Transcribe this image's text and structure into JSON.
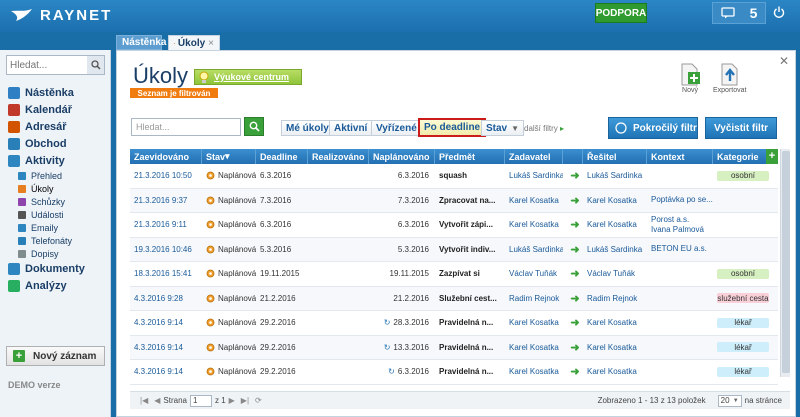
{
  "header": {
    "logo_text": "RAYNET",
    "support_label": "PODPORA",
    "messages_count": "5"
  },
  "sidebar": {
    "search_placeholder": "Hledat...",
    "items": [
      {
        "label": "Nástěnka",
        "color": "#2e7fc4"
      },
      {
        "label": "Kalendář",
        "color": "#c0392b"
      },
      {
        "label": "Adresář",
        "color": "#d35400"
      },
      {
        "label": "Obchod",
        "color": "#2980b9"
      },
      {
        "label": "Aktivity",
        "color": "#2e86c1"
      }
    ],
    "subitems": [
      {
        "label": "Přehled",
        "color": "#2e86c1"
      },
      {
        "label": "Úkoly",
        "color": "#e67e22"
      },
      {
        "label": "Schůzky",
        "color": "#8e44ad"
      },
      {
        "label": "Události",
        "color": "#555555"
      },
      {
        "label": "Emaily",
        "color": "#2e86c1"
      },
      {
        "label": "Telefonáty",
        "color": "#2980b9"
      },
      {
        "label": "Dopisy",
        "color": "#7f8c8d"
      }
    ],
    "items2": [
      {
        "label": "Dokumenty",
        "color": "#2e86c1"
      },
      {
        "label": "Analýzy",
        "color": "#27ae60"
      }
    ],
    "new_record": "Nový záznam",
    "demo": "DEMO verze"
  },
  "tabs": [
    {
      "label": "Nástěnka"
    },
    {
      "label": "Úkoly"
    }
  ],
  "main": {
    "title": "Úkoly",
    "learning_center": "Výukové centrum",
    "filtered_badge": "Seznam je filtrován",
    "new_label": "Nový",
    "export_label": "Exportovat"
  },
  "filters": {
    "search_placeholder": "Hledat...",
    "buttons": [
      "Mé úkoly",
      "Aktivní",
      "Vyřízené",
      "Po deadline",
      "Stav"
    ],
    "more": "další filtry",
    "advanced": "Pokročilý filtr",
    "clear": "Vyčistit filtr"
  },
  "table": {
    "columns": [
      "Zaevidováno",
      "Stav",
      "Deadline",
      "Realizováno",
      "Naplánováno",
      "Předmět",
      "Zadavatel",
      "",
      "Řešitel",
      "Kontext",
      "Kategorie"
    ],
    "rows": [
      {
        "reg": "21.3.2016 10:50",
        "state": "Naplánován",
        "deadline": "6.3.2016",
        "real": "",
        "plan": "6.3.2016",
        "subject": "squash",
        "assigner": "Lukáš Sardinka",
        "solver": "Lukáš Sardinka",
        "context": [],
        "cat": "osobní",
        "cat_bg": "#d7f0c2",
        "repeat": false
      },
      {
        "reg": "21.3.2016 9:37",
        "state": "Naplánován",
        "deadline": "7.3.2016",
        "real": "",
        "plan": "7.3.2016",
        "subject": "Zpracovat na...",
        "assigner": "Karel Kosatka",
        "solver": "Karel Kosatka",
        "context": [
          "Poptávka po se..."
        ],
        "cat": "",
        "cat_bg": "",
        "repeat": false
      },
      {
        "reg": "21.3.2016 9:11",
        "state": "Naplánován",
        "deadline": "6.3.2016",
        "real": "",
        "plan": "6.3.2016",
        "subject": "Vytvořit zápi...",
        "assigner": "Karel Kosatka",
        "solver": "Karel Kosatka",
        "context": [
          "Porost a.s.",
          "Ivana Palmová"
        ],
        "cat": "",
        "cat_bg": "",
        "repeat": false
      },
      {
        "reg": "19.3.2016 10:46",
        "state": "Naplánován",
        "deadline": "5.3.2016",
        "real": "",
        "plan": "5.3.2016",
        "subject": "Vytvořit indiv...",
        "assigner": "Lukáš Sardinka",
        "solver": "Lukáš Sardinka",
        "context": [
          "BETON EU a.s."
        ],
        "cat": "",
        "cat_bg": "",
        "repeat": false
      },
      {
        "reg": "18.3.2016 15:41",
        "state": "Naplánován",
        "deadline": "19.11.2015",
        "real": "",
        "plan": "19.11.2015",
        "subject": "Zazpívat si",
        "assigner": "Václav Tuňák",
        "solver": "Václav Tuňák",
        "context": [],
        "cat": "osobní",
        "cat_bg": "#d7f0c2",
        "repeat": false
      },
      {
        "reg": "4.3.2016 9:28",
        "state": "Naplánován",
        "deadline": "21.2.2016",
        "real": "",
        "plan": "21.2.2016",
        "subject": "Služební cest...",
        "assigner": "Radim Rejnok",
        "solver": "Radim Rejnok",
        "context": [],
        "cat": "služební cesta",
        "cat_bg": "#f9d0d8",
        "repeat": false
      },
      {
        "reg": "4.3.2016 9:14",
        "state": "Naplánován",
        "deadline": "29.2.2016",
        "real": "",
        "plan": "28.3.2016",
        "subject": "Pravidelná n...",
        "assigner": "Karel Kosatka",
        "solver": "Karel Kosatka",
        "context": [],
        "cat": "lékař",
        "cat_bg": "#cdeefa",
        "repeat": true
      },
      {
        "reg": "4.3.2016 9:14",
        "state": "Naplánován",
        "deadline": "29.2.2016",
        "real": "",
        "plan": "13.3.2016",
        "subject": "Pravidelná n...",
        "assigner": "Karel Kosatka",
        "solver": "Karel Kosatka",
        "context": [],
        "cat": "lékař",
        "cat_bg": "#cdeefa",
        "repeat": true
      },
      {
        "reg": "4.3.2016 9:14",
        "state": "Naplánován",
        "deadline": "29.2.2016",
        "real": "",
        "plan": "6.3.2016",
        "subject": "Pravidelná n...",
        "assigner": "Karel Kosatka",
        "solver": "Karel Kosatka",
        "context": [],
        "cat": "lékař",
        "cat_bg": "#cdeefa",
        "repeat": true
      }
    ]
  },
  "pager": {
    "page_label": "Strana",
    "page_value": "1",
    "of": "z 1",
    "summary": "Zobrazeno 1 - 13 z 13 položek",
    "per_page": "20",
    "per_page_suffix": "na stránce"
  }
}
